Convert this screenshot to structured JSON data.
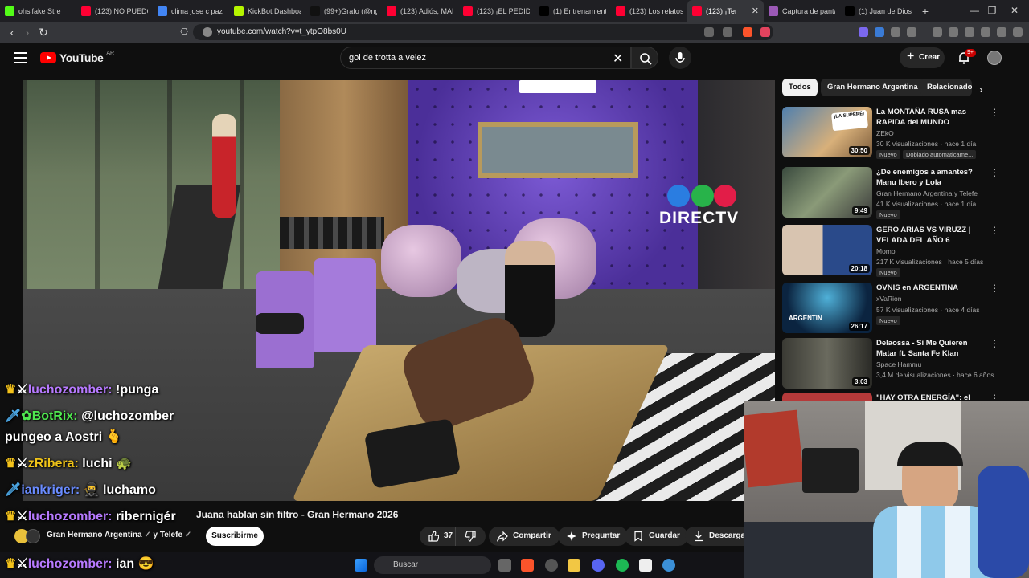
{
  "browser": {
    "tabs": [
      {
        "label": "ohsifake Stre",
        "color": "#53fc18"
      },
      {
        "label": "(123) NO PUEDO",
        "color": "#ff0033"
      },
      {
        "label": "clima jose c paz",
        "color": "#4285f4"
      },
      {
        "label": "KickBot Dashboa",
        "color": "#b6f500"
      },
      {
        "label": "(99+)Grafo (@ng",
        "color": "#111111"
      },
      {
        "label": "(123) Adiós, MAR",
        "color": "#ff0033"
      },
      {
        "label": "(123) ¡EL PEDIDO",
        "color": "#ff0033"
      },
      {
        "label": "(1) Entrenamient",
        "color": "#000000"
      },
      {
        "label": "(123) Los relatos",
        "color": "#ff0033"
      },
      {
        "label": "(123) ¡Ter",
        "color": "#ff0033",
        "active": true
      },
      {
        "label": "Captura de panta",
        "color": "#9b59b6"
      },
      {
        "label": "(1) Juan de Dios",
        "color": "#000000"
      }
    ],
    "url": "youtube.com/watch?v=t_ytpO8bs0U"
  },
  "header": {
    "logo_text": "YouTube",
    "country": "AR",
    "search_value": "gol de trotta a velez",
    "create_label": "Crear",
    "notif_badge": "9+"
  },
  "video": {
    "title_tail": "Juana hablan sin filtro - Gran Hermano 2026",
    "overlay_brand": "DIRECTV",
    "channel": "Gran Hermano Argentina",
    "channel_suffix": "y Telefe",
    "subscribe_label": "Suscribirme",
    "likes": "37",
    "share_label": "Compartir",
    "ask_label": "Preguntar",
    "save_label": "Guardar",
    "download_label": "Descargar"
  },
  "sidebar": {
    "chips": [
      "Todos",
      "Gran Hermano Argentina",
      "Relacionado"
    ],
    "recs": [
      {
        "title": "La MONTAÑA RUSA mas RAPIDA del MUNDO",
        "channel": "ZEkO",
        "meta": "30 K visualizaciones · hace 1 día",
        "duration": "30:50",
        "badge": "Nuevo",
        "badge2": "Doblado automáticame..."
      },
      {
        "title": "¿De enemigos a amantes? Manu Ibero y Lola Tomaszeus...",
        "channel": "Gran Hermano Argentina y Telefe",
        "meta": "41 K visualizaciones · hace 1 día",
        "duration": "9:49",
        "badge": "Nuevo"
      },
      {
        "title": "GERO ARIAS VS VIRUZZ | VELADA DEL AÑO 6",
        "channel": "Momo",
        "meta": "217 K visualizaciones · hace 5 días",
        "duration": "20:18",
        "badge": "Nuevo"
      },
      {
        "title": "OVNIS en ARGENTINA",
        "channel": "xVaRion",
        "meta": "57 K visualizaciones · hace 4 días",
        "duration": "26:17",
        "badge": "Nuevo"
      },
      {
        "title": "Delaossa - Si Me Quieren Matar ft. Santa Fe Klan",
        "channel": "Space Hammu",
        "meta": "3,4 M de visualizaciones · hace 6 años",
        "duration": "3:03"
      },
      {
        "title": "\"HAY OTRA ENERGÍA\": el",
        "channel": "",
        "meta": ""
      }
    ]
  },
  "chat": [
    {
      "user": "luchozomber",
      "msg": "!punga",
      "color": "#b77aff"
    },
    {
      "user": "BotRix",
      "msg": "@luchozomber",
      "color": "#4fe84f"
    },
    {
      "user": "",
      "msg": "pungeo a Aostri 🫰"
    },
    {
      "user": "zRibera",
      "msg": "luchi 🐢",
      "color": "#f0c419"
    },
    {
      "user": "iankriger",
      "msg": "🥷 luchamo",
      "color": "#6a8cff"
    },
    {
      "user": "luchozomber",
      "msg": "ribernigér",
      "color": "#b77aff"
    },
    {
      "user": "luchozomber",
      "msg": "ian 😎",
      "color": "#b77aff"
    }
  ],
  "taskbar": {
    "search_label": "Buscar"
  }
}
